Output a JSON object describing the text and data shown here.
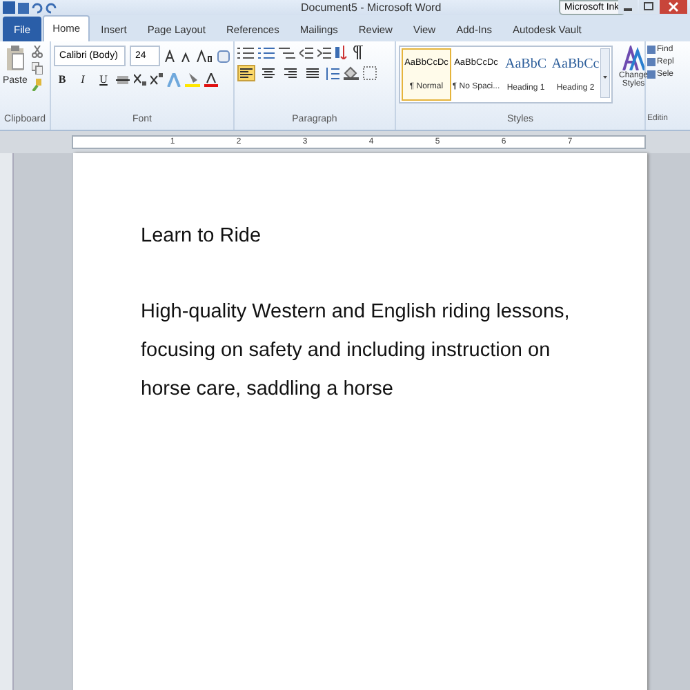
{
  "window": {
    "title": "Document5 - Microsoft Word",
    "ink_toolbar": "Microsoft Ink"
  },
  "tabs": [
    {
      "label": "File",
      "kind": "file",
      "selected": false
    },
    {
      "label": "Home",
      "kind": "tab",
      "selected": true
    },
    {
      "label": "Insert",
      "kind": "tab",
      "selected": false
    },
    {
      "label": "Page Layout",
      "kind": "tab",
      "selected": false
    },
    {
      "label": "References",
      "kind": "tab",
      "selected": false
    },
    {
      "label": "Mailings",
      "kind": "tab",
      "selected": false
    },
    {
      "label": "Review",
      "kind": "tab",
      "selected": false
    },
    {
      "label": "View",
      "kind": "tab",
      "selected": false
    },
    {
      "label": "Add-Ins",
      "kind": "tab",
      "selected": false
    },
    {
      "label": "Autodesk Vault",
      "kind": "tab",
      "selected": false
    }
  ],
  "clipboard": {
    "paste": "Paste",
    "group": "Clipboard"
  },
  "font": {
    "name": "Calibri (Body)",
    "size": "24",
    "format_buttons": [
      "B",
      "I",
      "U"
    ],
    "group": "Font"
  },
  "paragraph": {
    "alignment": [
      {
        "selected": true
      },
      {
        "selected": false
      },
      {
        "selected": false
      },
      {
        "selected": false
      }
    ],
    "group": "Paragraph"
  },
  "styles": {
    "items": [
      {
        "preview": "AaBbCcDc",
        "label": "¶ Normal",
        "kind": "body",
        "selected": true
      },
      {
        "preview": "AaBbCcDc",
        "label": "¶ No Spaci...",
        "kind": "body",
        "selected": false
      },
      {
        "preview": "AaBbC",
        "label": "Heading 1",
        "kind": "heading",
        "selected": false
      },
      {
        "preview": "AaBbCc",
        "label": "Heading 2",
        "kind": "heading",
        "selected": false
      }
    ],
    "change_styles": "Change Styles",
    "group": "Styles"
  },
  "editing": {
    "items": [
      "Find",
      "Repl",
      "Sele"
    ],
    "group": "Editin"
  },
  "ruler": [
    "1",
    "2",
    "3",
    "4",
    "5",
    "6",
    "7"
  ],
  "document": {
    "paragraphs": [
      "Learn to Ride",
      "High-quality Western and English riding lessons, focusing on safety and including instruction on horse care, saddling a horse"
    ]
  }
}
